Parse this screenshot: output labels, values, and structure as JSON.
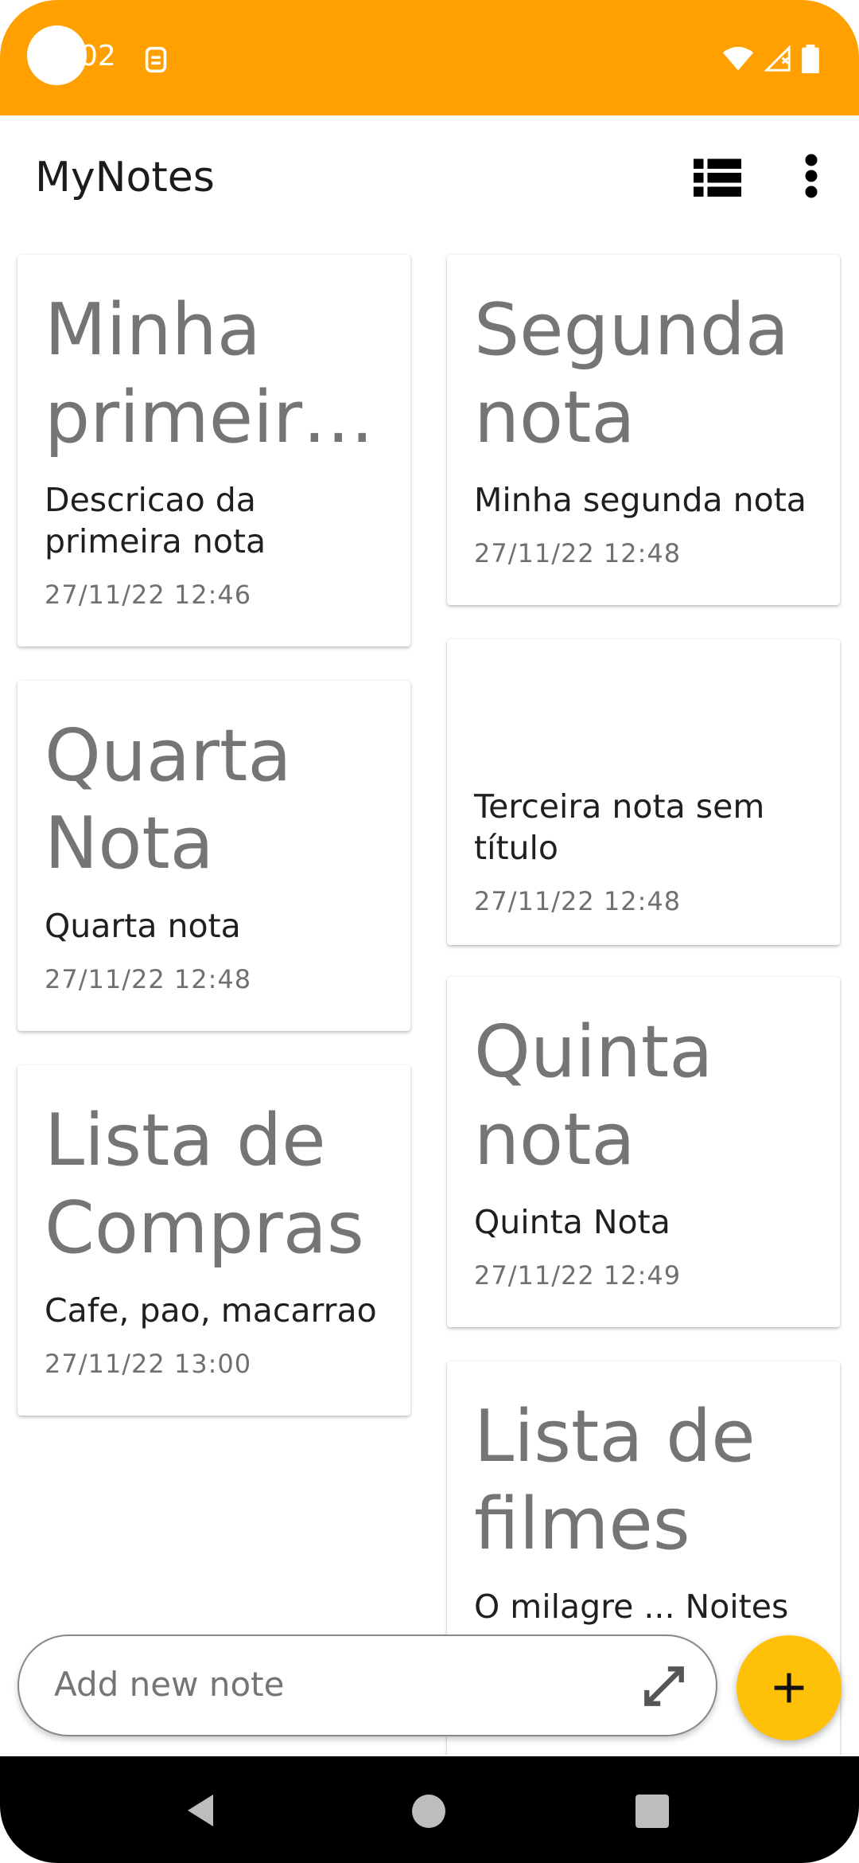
{
  "status_bar": {
    "time": "02",
    "icons": [
      "notification-icon",
      "wifi-icon",
      "signal-icon",
      "battery-icon"
    ],
    "bg_color": "#FFA000"
  },
  "app_bar": {
    "title": "MyNotes",
    "icons": [
      "view-list-icon",
      "more-vert-icon"
    ]
  },
  "notes": [
    {
      "title": "Minha primeira nota",
      "body": "Descricao da primeira nota",
      "date": "27/11/22 12:46"
    },
    {
      "title": "Segunda nota",
      "body": "Minha segunda nota",
      "date": "27/11/22 12:48"
    },
    {
      "title": "Quarta Nota",
      "body": "Quarta nota",
      "date": "27/11/22 12:48"
    },
    {
      "title": "",
      "body": "Terceira nota sem título",
      "date": "27/11/22 12:48"
    },
    {
      "title": "Lista de Compras",
      "body": "Cafe, pao, macarrao",
      "date": "27/11/22 13:00"
    },
    {
      "title": "Quinta nota",
      "body": "Quinta Nota",
      "date": "27/11/22 12:49"
    },
    {
      "title": "Lista de filmes",
      "body": "O milagre ... Noites Brutais",
      "date": ""
    }
  ],
  "add_note": {
    "placeholder": "Add new note",
    "expand_icon": "expand-icon"
  },
  "fab": {
    "icon": "plus-icon",
    "color": "#FFC107"
  },
  "nav_bar": {
    "icons": [
      "back-icon",
      "home-icon",
      "recents-icon"
    ]
  }
}
